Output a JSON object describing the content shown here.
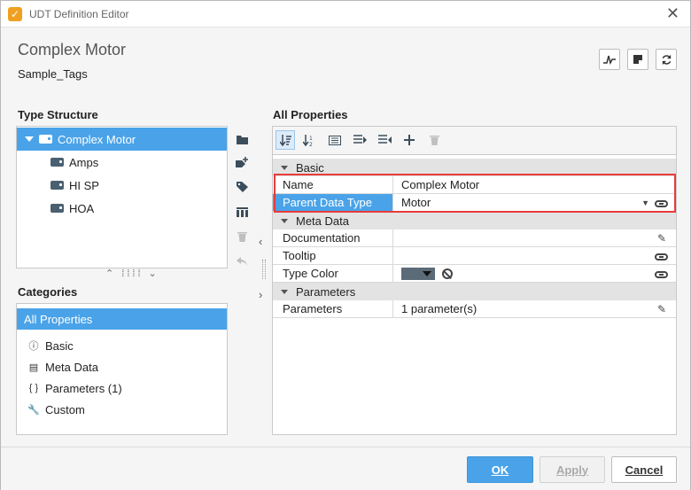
{
  "window": {
    "title": "UDT Definition Editor"
  },
  "header": {
    "title": "Complex Motor",
    "subtitle": "Sample_Tags"
  },
  "type_structure": {
    "label": "Type Structure",
    "root": "Complex Motor",
    "children": [
      "Amps",
      "HI SP",
      "HOA"
    ]
  },
  "categories": {
    "label": "Categories",
    "items": [
      {
        "label": "All Properties",
        "icon": "list-icon"
      },
      {
        "label": "Basic",
        "icon": "info-icon"
      },
      {
        "label": "Meta Data",
        "icon": "database-icon"
      },
      {
        "label": "Parameters (1)",
        "icon": "braces-icon"
      },
      {
        "label": "Custom",
        "icon": "wrench-icon"
      }
    ]
  },
  "all_properties": {
    "label": "All Properties",
    "sections": [
      {
        "name": "Basic",
        "rows": [
          {
            "name": "Name",
            "value": "Complex Motor"
          },
          {
            "name": "Parent Data Type",
            "value": "Motor"
          }
        ]
      },
      {
        "name": "Meta Data",
        "rows": [
          {
            "name": "Documentation",
            "value": ""
          },
          {
            "name": "Tooltip",
            "value": ""
          },
          {
            "name": "Type Color",
            "value": ""
          }
        ]
      },
      {
        "name": "Parameters",
        "rows": [
          {
            "name": "Parameters",
            "value": "1 parameter(s)"
          }
        ]
      }
    ]
  },
  "colors": {
    "accent": "#4aa3e8",
    "highlight": "#e83c3c",
    "type_color": "#5c6b78"
  },
  "footer": {
    "ok": "OK",
    "apply": "Apply",
    "cancel": "Cancel"
  }
}
